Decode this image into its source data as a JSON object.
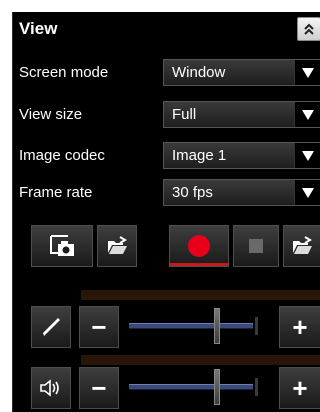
{
  "panel": {
    "title": "View"
  },
  "settings": [
    {
      "label": "Screen mode",
      "value": "Window"
    },
    {
      "label": "View size",
      "value": "Full"
    },
    {
      "label": "Image codec",
      "value": "Image 1"
    },
    {
      "label": "Frame rate",
      "value": "30 fps"
    }
  ],
  "controls": {
    "buttons": [
      "snapshot-icon",
      "open-folder-icon",
      "record-icon",
      "stop-icon",
      "open-folder-icon"
    ],
    "record_color": "#e8001a",
    "stop_color": "#6a6a6a"
  },
  "ptz_slider": {
    "icon": "pen-icon",
    "minus": "−",
    "plus": "+",
    "level": 0.72
  },
  "volume_slider": {
    "icon": "speaker-icon",
    "minus": "−",
    "plus": "+",
    "level": 0.72
  },
  "colors": {
    "accent_track": "#3c4a7a",
    "background": "#000000"
  }
}
